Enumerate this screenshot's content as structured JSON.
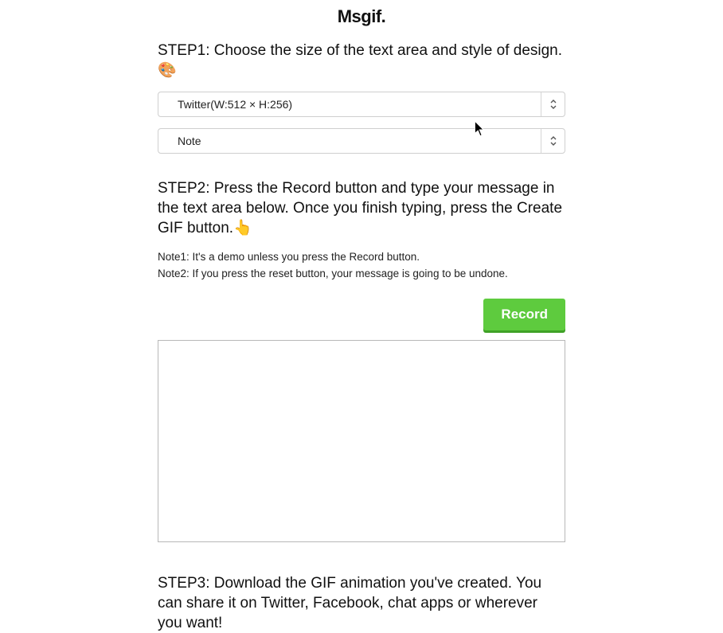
{
  "logo": "Msgif.",
  "step1": {
    "heading": "STEP1: Choose the size of the text area and style of design.",
    "emoji": "🎨",
    "size_select": "Twitter(W:512 × H:256)",
    "style_select": "Note"
  },
  "step2": {
    "heading": "STEP2: Press the Record button and type your message in the text area below. Once you finish typing, press the Create GIF button.",
    "emoji": "👆",
    "note1": "Note1: It's a demo unless you press the Record button.",
    "note2": "Note2: If you press the reset button, your message is going to be undone.",
    "record_label": "Record"
  },
  "step3": {
    "heading": "STEP3: Download the GIF animation you've created. You can share it on Twitter, Facebook, chat apps or wherever you want!"
  }
}
